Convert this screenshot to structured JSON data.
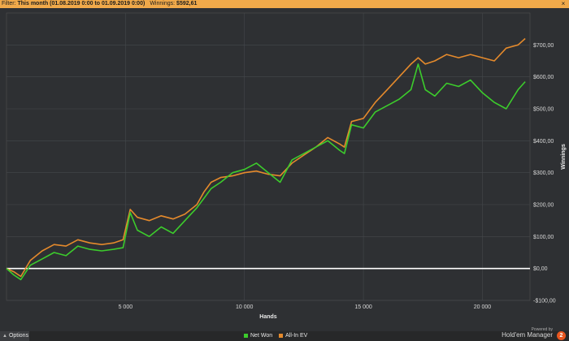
{
  "filter": {
    "label": "Filter:",
    "range": "This month (01.08.2019 0:00 to 01.09.2019 0:00)",
    "winnings_label": "Winnings:",
    "winnings_value": "$592,61",
    "close_icon": "×"
  },
  "bottom": {
    "options_label": "Options",
    "powered_by": "Powered by",
    "brand_name": "Hold'em Manager",
    "brand_logo": "2"
  },
  "chart_data": {
    "type": "line",
    "xlabel": "Hands",
    "ylabel": "Winnings",
    "xlim": [
      0,
      22000
    ],
    "ylim": [
      -100,
      800
    ],
    "x_ticks": [
      5000,
      10000,
      15000,
      20000
    ],
    "x_tick_labels": [
      "5 000",
      "10 000",
      "15 000",
      "20 000"
    ],
    "y_ticks": [
      -100,
      0,
      100,
      200,
      300,
      400,
      500,
      600,
      700
    ],
    "y_tick_labels": [
      "-$100,00",
      "$0,00",
      "$100,00",
      "$200,00",
      "$300,00",
      "$400,00",
      "$500,00",
      "$600,00",
      "$700,00"
    ],
    "grid": true,
    "zero_line": true,
    "legend_position": "bottom-center",
    "series": [
      {
        "name": "Net Won",
        "color": "#3ccc2c",
        "x": [
          0,
          300,
          600,
          1000,
          1500,
          2000,
          2500,
          3000,
          3500,
          4000,
          4500,
          4900,
          5200,
          5500,
          6000,
          6500,
          7000,
          7500,
          8000,
          8300,
          8600,
          9000,
          9500,
          10000,
          10500,
          11000,
          11500,
          12000,
          12500,
          13000,
          13500,
          14000,
          14200,
          14500,
          15000,
          15500,
          16000,
          16500,
          17000,
          17300,
          17600,
          18000,
          18500,
          19000,
          19500,
          20000,
          20500,
          21000,
          21500,
          21800
        ],
        "y": [
          0,
          -20,
          -35,
          10,
          30,
          50,
          40,
          70,
          60,
          55,
          60,
          65,
          175,
          120,
          100,
          130,
          110,
          150,
          190,
          220,
          250,
          270,
          300,
          310,
          330,
          300,
          270,
          340,
          360,
          380,
          400,
          370,
          360,
          450,
          440,
          490,
          510,
          530,
          560,
          640,
          560,
          540,
          580,
          570,
          590,
          550,
          520,
          500,
          560,
          585
        ]
      },
      {
        "name": "All-In EV",
        "color": "#e58a2c",
        "x": [
          0,
          300,
          600,
          1000,
          1500,
          2000,
          2500,
          3000,
          3500,
          4000,
          4500,
          4900,
          5200,
          5500,
          6000,
          6500,
          7000,
          7500,
          8000,
          8300,
          8600,
          9000,
          9500,
          10000,
          10500,
          11000,
          11500,
          12000,
          12500,
          13000,
          13500,
          14000,
          14200,
          14500,
          15000,
          15500,
          16000,
          16500,
          17000,
          17300,
          17600,
          18000,
          18500,
          19000,
          19500,
          20000,
          20500,
          21000,
          21500,
          21800
        ],
        "y": [
          0,
          -10,
          -25,
          25,
          55,
          75,
          70,
          90,
          80,
          75,
          80,
          90,
          185,
          160,
          150,
          165,
          155,
          170,
          200,
          240,
          270,
          285,
          290,
          300,
          305,
          295,
          290,
          330,
          355,
          380,
          410,
          390,
          380,
          460,
          470,
          520,
          560,
          600,
          640,
          660,
          640,
          650,
          670,
          660,
          670,
          660,
          650,
          690,
          700,
          720
        ]
      }
    ]
  }
}
